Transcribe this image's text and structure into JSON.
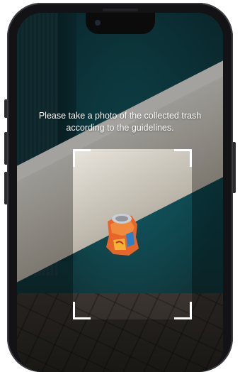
{
  "camera": {
    "instruction_line1": "Please take a photo of the collected trash",
    "instruction_line2": "according to the guidelines."
  },
  "icons": {
    "frame_corners": "viewfinder-corners-icon",
    "front_camera": "front-camera-icon"
  },
  "colors": {
    "frame": "#ffffff",
    "wall": "#0f3a42",
    "ledge": "#e9e6df",
    "can_orange": "#e8652a",
    "can_blue": "#2f7fc4"
  }
}
